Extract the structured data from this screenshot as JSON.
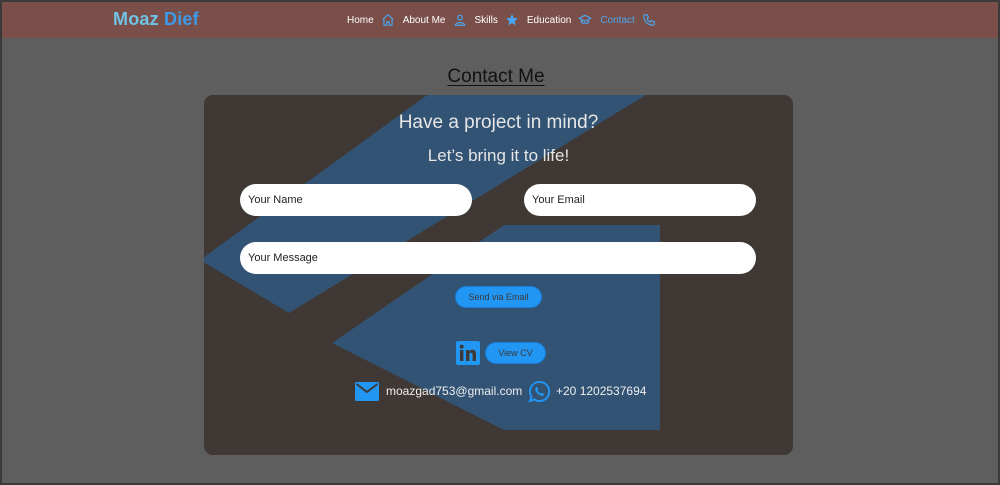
{
  "brand": {
    "first": "Moaz",
    "last": "Dief"
  },
  "nav": [
    {
      "label": "Home",
      "icon": "home-icon"
    },
    {
      "label": "About Me",
      "icon": "user-icon"
    },
    {
      "label": "Skills",
      "icon": "star-icon"
    },
    {
      "label": "Education",
      "icon": "graduation-cap-icon"
    },
    {
      "label": "Contact",
      "icon": "phone-icon",
      "active": true
    }
  ],
  "section": {
    "title": "Contact Me"
  },
  "card": {
    "heading": "Have a project in mind?",
    "subheading": "Let’s bring it to life!"
  },
  "form": {
    "name_placeholder": "Your Name",
    "email_placeholder": "Your Email",
    "message_placeholder": "Your Message",
    "send_label": "Send via Email"
  },
  "links": {
    "linkedin_icon": "linkedin-icon",
    "cv_label": "View CV"
  },
  "contact": {
    "email": "moazgad753@gmail.com",
    "phone": "+20 1202537694"
  },
  "colors": {
    "navbar": "#7b4f49",
    "accent": "#2196f3",
    "card": "#3f3834",
    "background": "#5e5e5e"
  }
}
